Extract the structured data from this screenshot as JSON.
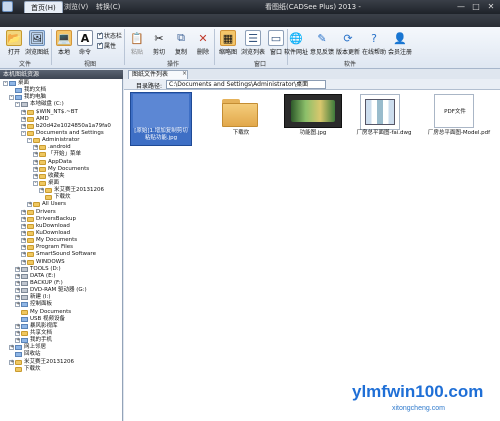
{
  "window": {
    "title": "看图纸(CADSee Plus) 2013 -",
    "controls": [
      "—",
      "□",
      "✕"
    ]
  },
  "ribbon_tabs": [
    {
      "label": "首页(H)",
      "active": true
    },
    {
      "label": "浏览(V)",
      "active": false
    },
    {
      "label": "转换(C)",
      "active": false
    }
  ],
  "ribbon": {
    "file_group": {
      "label": "文件",
      "buttons": [
        "打开",
        "浏览图纸"
      ]
    },
    "view_group": {
      "label": "视图",
      "buttons": [
        "本地",
        "命令"
      ],
      "checks": [
        {
          "label": "状态栏",
          "checked": true
        },
        {
          "label": "属性",
          "checked": true
        }
      ]
    },
    "action_group": {
      "label": "操作",
      "buttons": [
        "粘贴",
        "剪切",
        "复制",
        "删除"
      ]
    },
    "window_group": {
      "label": "窗口",
      "buttons": [
        "缩略图",
        "浏览列表",
        "窗口"
      ]
    },
    "software_group": {
      "label": "软件",
      "buttons": [
        "软件网址",
        "意见反馈",
        "版本更新",
        "在线帮助",
        "会员注册"
      ]
    }
  },
  "left_panel": {
    "header": "本机图纸资源",
    "tree": [
      {
        "label": "桌面",
        "depth": 0,
        "exp": "-",
        "icon": "special"
      },
      {
        "label": "我的文档",
        "depth": 1,
        "exp": "",
        "icon": "special"
      },
      {
        "label": "我的电脑",
        "depth": 1,
        "exp": "-",
        "icon": "special"
      },
      {
        "label": "本地磁盘 (C:)",
        "depth": 2,
        "exp": "-",
        "icon": "drive"
      },
      {
        "label": "$WIN_NT$.~BT",
        "depth": 3,
        "exp": "+",
        "icon": "folder"
      },
      {
        "label": "AMD",
        "depth": 3,
        "exp": "+",
        "icon": "folder"
      },
      {
        "label": "b20d42e1024850a1a79fa0",
        "depth": 3,
        "exp": "+",
        "icon": "folder"
      },
      {
        "label": "Documents and Settings",
        "depth": 3,
        "exp": "-",
        "icon": "folder"
      },
      {
        "label": "Administrator",
        "depth": 4,
        "exp": "-",
        "icon": "folder"
      },
      {
        "label": ".android",
        "depth": 5,
        "exp": "+",
        "icon": "folder"
      },
      {
        "label": "「开始」菜单",
        "depth": 5,
        "exp": "+",
        "icon": "folder"
      },
      {
        "label": "AppData",
        "depth": 5,
        "exp": "+",
        "icon": "folder"
      },
      {
        "label": "My Documents",
        "depth": 5,
        "exp": "+",
        "icon": "folder"
      },
      {
        "label": "收藏夹",
        "depth": 5,
        "exp": "+",
        "icon": "folder"
      },
      {
        "label": "桌面",
        "depth": 5,
        "exp": "-",
        "icon": "folder"
      },
      {
        "label": "米艾赛王20131206",
        "depth": 6,
        "exp": "+",
        "icon": "folder"
      },
      {
        "label": "下载炊",
        "depth": 6,
        "exp": "",
        "icon": "folder"
      },
      {
        "label": "All Users",
        "depth": 4,
        "exp": "+",
        "icon": "folder"
      },
      {
        "label": "Drivers",
        "depth": 3,
        "exp": "+",
        "icon": "folder"
      },
      {
        "label": "DriversBackup",
        "depth": 3,
        "exp": "+",
        "icon": "folder"
      },
      {
        "label": "kuDownload",
        "depth": 3,
        "exp": "+",
        "icon": "folder"
      },
      {
        "label": "KuDownload",
        "depth": 3,
        "exp": "+",
        "icon": "folder"
      },
      {
        "label": "My Documents",
        "depth": 3,
        "exp": "+",
        "icon": "folder"
      },
      {
        "label": "Program Files",
        "depth": 3,
        "exp": "+",
        "icon": "folder"
      },
      {
        "label": "SmartSound Software",
        "depth": 3,
        "exp": "+",
        "icon": "folder"
      },
      {
        "label": "WINDOWS",
        "depth": 3,
        "exp": "+",
        "icon": "folder"
      },
      {
        "label": "TOOLS (D:)",
        "depth": 2,
        "exp": "+",
        "icon": "drive"
      },
      {
        "label": "DATA (E:)",
        "depth": 2,
        "exp": "+",
        "icon": "drive"
      },
      {
        "label": "BACKUP (F:)",
        "depth": 2,
        "exp": "+",
        "icon": "drive"
      },
      {
        "label": "DVD-RAM 驱动器 (G:)",
        "depth": 2,
        "exp": "+",
        "icon": "drive"
      },
      {
        "label": "新建 (I:)",
        "depth": 2,
        "exp": "+",
        "icon": "drive"
      },
      {
        "label": "控制面板",
        "depth": 2,
        "exp": "+",
        "icon": "special"
      },
      {
        "label": "My Documents",
        "depth": 2,
        "exp": "",
        "icon": "folder"
      },
      {
        "label": "USB 视频设备",
        "depth": 2,
        "exp": "",
        "icon": "special"
      },
      {
        "label": "暴风影视库",
        "depth": 2,
        "exp": "+",
        "icon": "special"
      },
      {
        "label": "共享文档",
        "depth": 2,
        "exp": "+",
        "icon": "folder"
      },
      {
        "label": "我的手机",
        "depth": 2,
        "exp": "+",
        "icon": "special"
      },
      {
        "label": "网上邻居",
        "depth": 1,
        "exp": "+",
        "icon": "special"
      },
      {
        "label": "回收站",
        "depth": 1,
        "exp": "",
        "icon": "special"
      },
      {
        "label": "米艾赛王20131206",
        "depth": 1,
        "exp": "+",
        "icon": "folder"
      },
      {
        "label": "下载炊",
        "depth": 1,
        "exp": "",
        "icon": "folder"
      }
    ]
  },
  "document_tab": {
    "label": "图纸文件列表",
    "close": "×"
  },
  "path_bar": {
    "label": "目录路径:",
    "value": "C:\\Documents and Settings\\Administrator\\桌面"
  },
  "files": [
    {
      "name": "[原始]1.增加复制剪切粘贴功能.jpg",
      "kind": "image-blue",
      "selected": true
    },
    {
      "name": "下载炊",
      "kind": "folder",
      "selected": false
    },
    {
      "name": "功能图.jpg",
      "kind": "image-dark",
      "selected": false
    },
    {
      "name": "厂房总平面图-fai.dwg",
      "kind": "dwg",
      "selected": false
    },
    {
      "name": "厂房总平面图-Model.pdf",
      "kind": "pdf",
      "pdf_label": "PDF文件",
      "selected": false
    }
  ],
  "watermark": {
    "main": "ylmfwin100.com",
    "sub": "xitongcheng.com"
  }
}
